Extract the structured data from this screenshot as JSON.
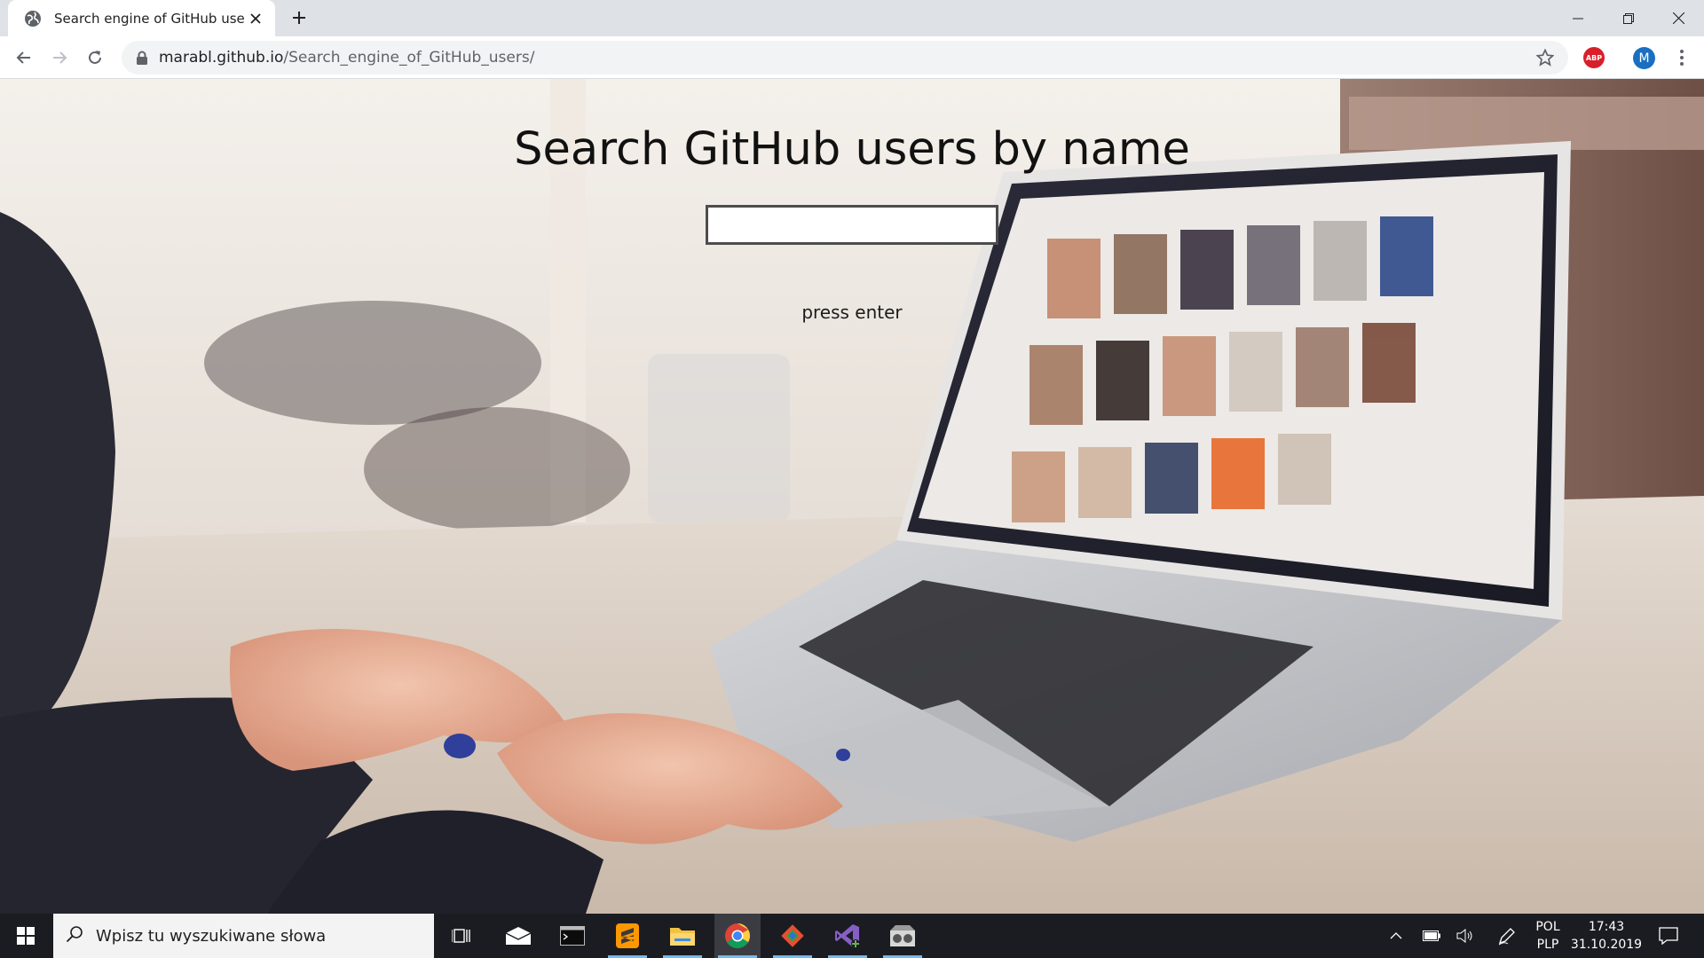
{
  "browser": {
    "tab": {
      "title": "Search engine of GitHub users",
      "favicon": "globe-icon"
    },
    "address": {
      "host": "marabl.github.io",
      "path": "/Search_engine_of_GitHub_users/"
    },
    "extensions": {
      "adblock_label": "ABP"
    },
    "profile_initial": "M"
  },
  "page": {
    "title": "Search GitHub users by name",
    "search": {
      "value": "",
      "placeholder": ""
    },
    "hint": "press enter"
  },
  "taskbar": {
    "search_placeholder": "Wpisz tu wyszukiwane słowa",
    "apps": [
      "task-view",
      "mail",
      "terminal",
      "sublime-text",
      "file-explorer",
      "chrome",
      "git",
      "visual-studio",
      "media-app"
    ],
    "language": {
      "code": "POL",
      "layout": "PLP"
    },
    "clock": {
      "time": "17:43",
      "date": "31.10.2019"
    }
  }
}
